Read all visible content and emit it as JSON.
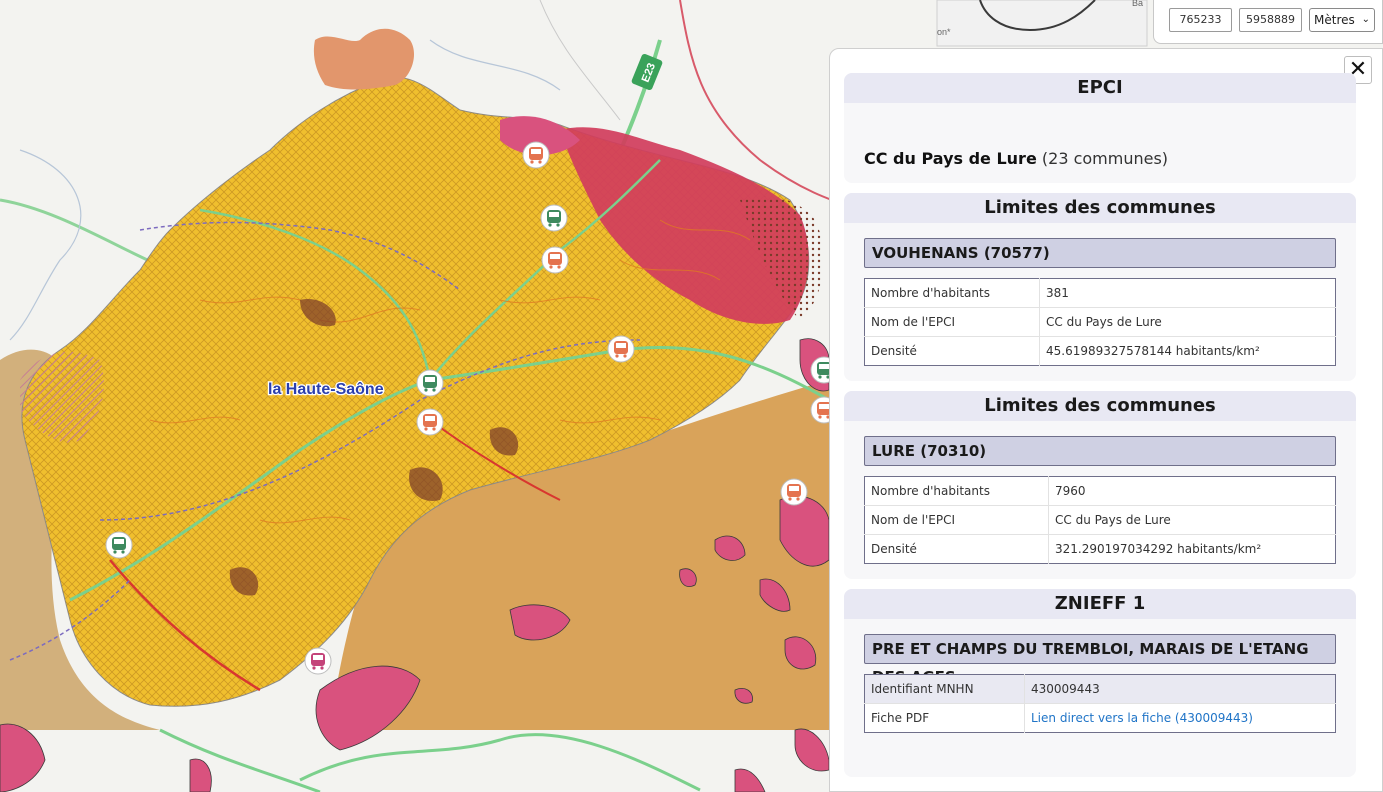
{
  "map": {
    "place_label": "la Haute-Saône",
    "road_label": "E23",
    "corner_label_1": "Ba",
    "corner_label_2": "on*",
    "colors": {
      "background": "#f3f3f0",
      "zone_yellow": "#f0bf2e",
      "zone_tan": "#d9a35a",
      "zone_pink": "#d9527e",
      "zone_red": "#d13d5c",
      "zone_salmon": "#e2966c",
      "road_green": "#7bd08c",
      "rail_purple": "#7c6bbf",
      "marker_green": "#3e8a5f",
      "marker_orange": "#e4734f",
      "marker_pink": "#c4437a"
    },
    "markers": [
      {
        "type": "train",
        "color": "orange"
      },
      {
        "type": "bus",
        "color": "green"
      },
      {
        "type": "train",
        "color": "orange"
      },
      {
        "type": "train",
        "color": "orange"
      },
      {
        "type": "bus",
        "color": "green"
      },
      {
        "type": "train",
        "color": "orange"
      },
      {
        "type": "bus",
        "color": "green"
      },
      {
        "type": "train",
        "color": "orange"
      },
      {
        "type": "bus",
        "color": "green"
      },
      {
        "type": "train",
        "color": "orange"
      },
      {
        "type": "tram",
        "color": "pink"
      }
    ]
  },
  "coords": {
    "x": "765233",
    "y": "5958889",
    "unit": "Mètres"
  },
  "panel": {
    "close_label": "✕",
    "epci": {
      "title": "EPCI",
      "name": "CC du Pays de Lure",
      "detail": "(23 communes)"
    },
    "communes": [
      {
        "title": "Limites des communes",
        "name": "VOUHENANS (70577)",
        "rows": [
          {
            "key": "Nombre d'habitants",
            "value": "381"
          },
          {
            "key": "Nom de l'EPCI",
            "value": "CC du Pays de Lure"
          },
          {
            "key": "Densité",
            "value": "45.61989327578144 habitants/km²"
          }
        ]
      },
      {
        "title": "Limites des communes",
        "name": "LURE (70310)",
        "rows": [
          {
            "key": "Nombre d'habitants",
            "value": "7960"
          },
          {
            "key": "Nom de l'EPCI",
            "value": "CC du Pays de Lure"
          },
          {
            "key": "Densité",
            "value": "321.290197034292 habitants/km²"
          }
        ]
      }
    ],
    "znieff": {
      "title": "ZNIEFF 1",
      "name": "PRE ET CHAMPS DU TREMBLOI, MARAIS DE L'ETANG DES AGES",
      "rows": [
        {
          "key": "Identifiant MNHN",
          "value": "430009443"
        },
        {
          "key": "Fiche PDF",
          "value": "Lien direct vers la fiche (430009443)"
        }
      ]
    }
  }
}
